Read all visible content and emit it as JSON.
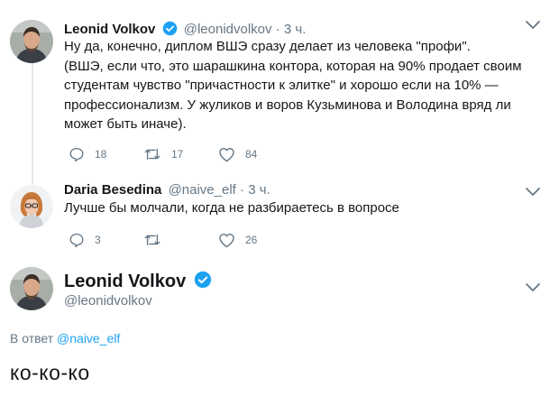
{
  "tweet1": {
    "name": "Leonid Volkov",
    "handle": "@leonidvolkov",
    "separator": "·",
    "time": "3 ч.",
    "text_lines": [
      "Ну да, конечно, диплом ВШЭ сразу делает из человека \"профи\".",
      "(ВШЭ, если что, это шарашкина контора, которая на 90% продает своим",
      "студентам чувство \"причастности к элитке\" и хорошо если на 10% —",
      "профессионализм. У жуликов и воров Кузьминова и Володина вряд ли",
      "может быть иначе)."
    ],
    "replies": "18",
    "retweets": "17",
    "likes": "84",
    "verified": true
  },
  "tweet2": {
    "name": "Daria Besedina",
    "handle": "@naive_elf",
    "separator": "·",
    "time": "3 ч.",
    "text": "Лучше бы молчали, когда не разбираетесь в вопросе",
    "replies": "3",
    "retweets": "",
    "likes": "26"
  },
  "tweet3": {
    "name": "Leonid Volkov",
    "handle": "@leonidvolkov",
    "reply_prefix": "В ответ",
    "reply_mention": "@naive_elf",
    "text": "ко-ко-ко",
    "verified": true
  },
  "icons": {
    "reply": "reply-icon",
    "retweet": "retweet-icon",
    "like": "heart-icon",
    "menu": "chevron-down-icon",
    "verified": "verified-badge-icon"
  },
  "colors": {
    "text": "#14171a",
    "muted": "#657786",
    "accent": "#1da1f2",
    "divider": "#e1e8ed"
  }
}
